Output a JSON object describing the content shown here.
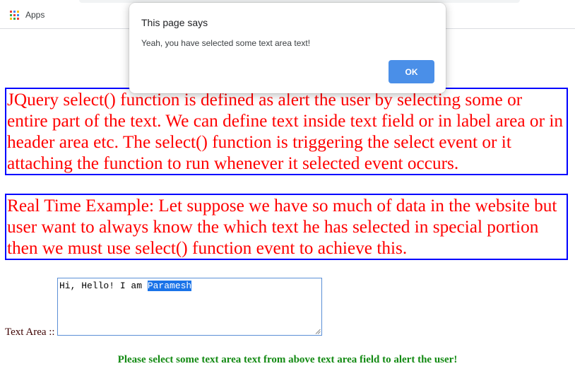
{
  "browser": {
    "bookmarks": {
      "apps_label": "Apps",
      "apps_icon": "apps-grid-icon",
      "apps_icon_colors": [
        "#ea4335",
        "#4285f4",
        "#fbbc05",
        "#34a853",
        "#ea4335",
        "#4285f4",
        "#fbbc05",
        "#34a853",
        "#ea4335"
      ]
    }
  },
  "content": {
    "paragraph1": "JQuery select() function is defined as alert the user by selecting some or entire part of the text. We can define text inside text field or in label area or in header area etc. The select() function is triggering the select event or it attaching the function to run whenever it selected event occurs.",
    "paragraph2": "Real Time Example: Let suppose we have so much of data in the website but user want to always know the which text he has selected in special portion then we must use select() function event to achieve this.",
    "textarea": {
      "label": "Text Area ::",
      "value_unselected": "Hi, Hello! I am ",
      "value_selected": "Paramesh"
    },
    "instruction": "Please select some text area text from above text area field to alert the user!"
  },
  "dialog": {
    "title": "This page says",
    "message": "Yeah, you have selected some text area text!",
    "ok_label": "OK"
  },
  "colors": {
    "paragraph_text": "#ff0000",
    "paragraph_border": "#0000ff",
    "instruction_text": "#138a13",
    "ok_button": "#4a8fe8",
    "selection_highlight": "#1a73e8"
  }
}
